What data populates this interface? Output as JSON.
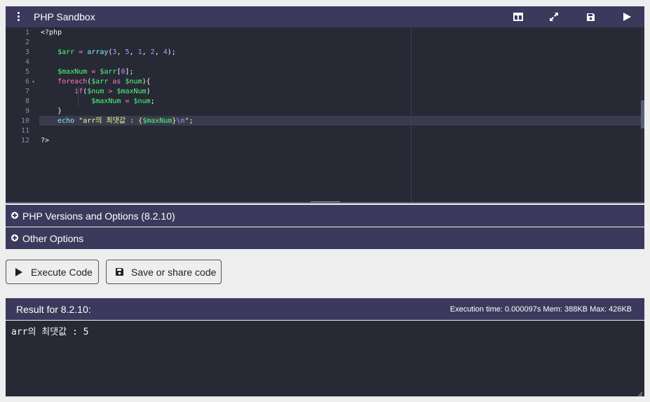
{
  "app": {
    "title": "PHP Sandbox"
  },
  "toolbar": {
    "icons": [
      "menu-icon",
      "split-layout-icon",
      "expand-icon",
      "save-icon",
      "run-icon"
    ]
  },
  "editor": {
    "line_numbers": [
      "1",
      "2",
      "3",
      "4",
      "5",
      "6",
      "7",
      "8",
      "9",
      "10",
      "11",
      "12"
    ],
    "active_line": "10"
  },
  "panels": {
    "php_versions": "PHP Versions and Options (8.2.10)",
    "other_options": "Other Options"
  },
  "actions": {
    "execute_label": "Execute Code",
    "save_share_label": "Save or share code"
  },
  "result": {
    "label": "Result for 8.2.10:",
    "stats": "Execution time: 0.000097s Mem: 388KB Max: 426KB",
    "output": "arr의 최댓값 : 5"
  },
  "colors": {
    "header_bg": "#3b3a5c",
    "editor_bg": "#272935",
    "variable": "#50fa7b",
    "operator": "#ff79c6",
    "number": "#bd93f9",
    "function": "#8be9fd",
    "string": "#f1fa8c"
  }
}
